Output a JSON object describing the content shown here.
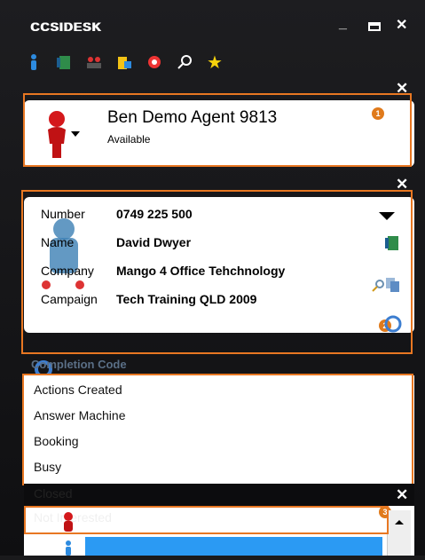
{
  "window": {
    "title": "CCSIDESK",
    "minimize_label": "_",
    "maximize_label": "▭",
    "close_label": "✕"
  },
  "toolbar": {
    "icons": [
      "person-info-icon",
      "phone-book-icon",
      "transfer-icon",
      "folder-icon",
      "headset-icon",
      "search-icon",
      "star-icon"
    ]
  },
  "agent": {
    "name": "Ben Demo Agent 9813",
    "status": "Available",
    "badge": "1"
  },
  "call": {
    "badge": "2",
    "fields": [
      {
        "label": "Number",
        "value": "0749 225 500"
      },
      {
        "label": "Name",
        "value": "David Dwyer"
      },
      {
        "label": "Company",
        "value": "Mango 4 Office Tehchnology"
      },
      {
        "label": "Campaign",
        "value": "Tech Training QLD 2009"
      }
    ]
  },
  "completion": {
    "heading": "Completion Code",
    "items": [
      "Actions Created",
      "Answer Machine",
      "Booking",
      "Busy",
      "Closed",
      "Not Interested"
    ]
  },
  "bottom": {
    "badge": "3"
  },
  "colors": {
    "accent": "#e87722",
    "selection": "#2b9af3"
  }
}
